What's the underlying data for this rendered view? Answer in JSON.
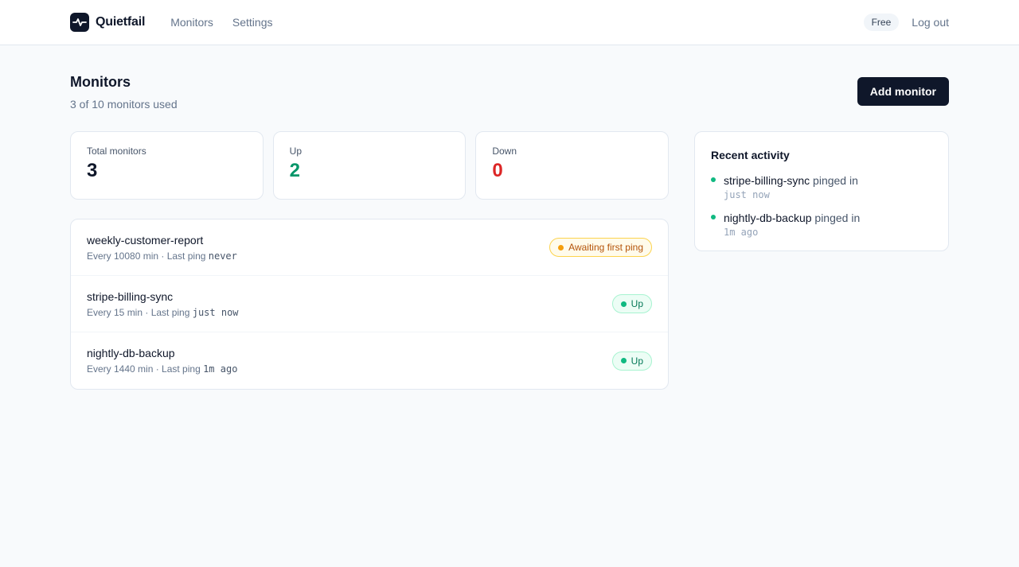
{
  "header": {
    "brand": "Quietfail",
    "nav": [
      {
        "label": "Monitors"
      },
      {
        "label": "Settings"
      }
    ],
    "plan_badge": "Free",
    "logout_label": "Log out"
  },
  "page": {
    "title": "Monitors",
    "subtitle": "3 of 10 monitors used",
    "add_button": "Add monitor"
  },
  "stats": [
    {
      "label": "Total monitors",
      "value": "3"
    },
    {
      "label": "Up",
      "value": "2"
    },
    {
      "label": "Down",
      "value": "0"
    }
  ],
  "monitors": [
    {
      "name": "weekly-customer-report",
      "interval": "Every 10080 min",
      "last_ping_prefix": " · Last ping ",
      "last_ping": "never",
      "status": "Awaiting first ping"
    },
    {
      "name": "stripe-billing-sync",
      "interval": "Every 15 min",
      "last_ping_prefix": " · Last ping ",
      "last_ping": "just now",
      "status": "Up"
    },
    {
      "name": "nightly-db-backup",
      "interval": "Every 1440 min",
      "last_ping_prefix": " · Last ping ",
      "last_ping": "1m ago",
      "status": "Up"
    }
  ],
  "activity": {
    "title": "Recent activity",
    "items": [
      {
        "name": "stripe-billing-sync",
        "action": " pinged in",
        "time": "just now"
      },
      {
        "name": "nightly-db-backup",
        "action": " pinged in",
        "time": "1m ago"
      }
    ]
  },
  "colors": {
    "accent": "#0f172a",
    "up": "#059669",
    "down": "#dc2626",
    "awaiting": "#f59e0b"
  }
}
